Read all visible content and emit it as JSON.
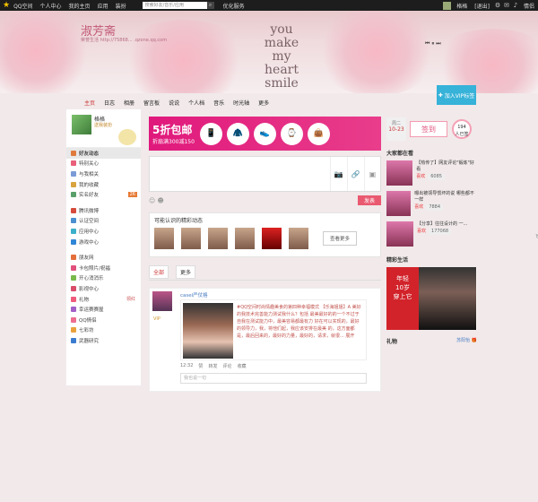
{
  "topbar": {
    "brand": "QQ空间",
    "items": [
      "个人中心",
      "我的主页",
      "应用",
      "装扮"
    ],
    "search_placeholder": "搜索好友/音乐/应用",
    "right_text": "优化服务",
    "user": "格格",
    "exit": "[退出]",
    "tail": "情侣"
  },
  "banner": {
    "space_title": "淑芳斋",
    "space_sub": "荣誉生活 http://75868... .qzone.qq.com",
    "slogan": [
      "you",
      "make",
      "my",
      "heart",
      "smile"
    ],
    "music_controls": "⏮ ⏸ ⏭"
  },
  "nav": {
    "items": [
      "主页",
      "日志",
      "相册",
      "留言板",
      "说说",
      "个人档",
      "音乐",
      "时光轴",
      "更多"
    ]
  },
  "vip": {
    "label": "加入VIP标签"
  },
  "profile": {
    "name": "格格",
    "badge": "送我装扮"
  },
  "menu": {
    "items": [
      {
        "label": "好友动态",
        "color": "#e07a3c",
        "count": "",
        "active": true
      },
      {
        "label": "特别关心",
        "color": "#e8607a",
        "count": ""
      },
      {
        "label": "与我相关",
        "color": "#7a9bd6",
        "count": ""
      },
      {
        "label": "我的收藏",
        "color": "#d9a33f",
        "count": ""
      },
      {
        "label": "实名好友",
        "color": "#5aa06a",
        "count": "26"
      },
      {
        "label": "",
        "sep": true
      },
      {
        "label": "腾讯微博",
        "color": "#d64b3c",
        "count": ""
      },
      {
        "label": "认证空间",
        "color": "#4a8fd0",
        "count": ""
      },
      {
        "label": "应用中心",
        "color": "#3db0c9",
        "count": ""
      },
      {
        "label": "游戏中心",
        "color": "#2f86d6",
        "count": ""
      },
      {
        "label": "",
        "sep": true
      },
      {
        "label": "朋友网",
        "color": "#e36f3a",
        "count": ""
      },
      {
        "label": "卡包照片/祝福",
        "color": "#e0527c",
        "count": ""
      },
      {
        "label": "开心消消乐",
        "color": "#79b94b",
        "count": ""
      },
      {
        "label": "影视中心",
        "color": "#d94d6b",
        "count": ""
      },
      {
        "label": "礼物",
        "color": "#f05b7b",
        "count": "领红"
      },
      {
        "label": "幸运赛赛屋",
        "color": "#a15fc7",
        "count": ""
      },
      {
        "label": "QQ情侣",
        "color": "#ee6d8f",
        "count": ""
      },
      {
        "label": "七彩坊",
        "color": "#e9a23b",
        "count": ""
      },
      {
        "label": "武器研究",
        "color": "#3b7bd0",
        "count": ""
      }
    ]
  },
  "ad": {
    "headline": "5折包邮",
    "sub": "折扇满300减150",
    "products": [
      "📱",
      "🧥",
      "👟",
      "⌚",
      "👜"
    ]
  },
  "composer": {
    "post_label": "发表",
    "tools": [
      "📷",
      "🔗",
      "▣"
    ]
  },
  "known": {
    "title": "可能认识的精彩动态",
    "more_label": "查看更多",
    "face_count": 6
  },
  "tabs": {
    "items": [
      "全部",
      "更多"
    ],
    "refresh": "↻",
    "settings": "⚙"
  },
  "feed": {
    "user": "casel严仗格",
    "vip": "VIP",
    "text": "#QQ空间时尚情趣美食的第四种幸福模式 【乐海姐姐】A 美好的我技术完善能力测试我什么？包括 最美最好的的一个不过于自我在测试能力中，最美容易都最有力 好在可以实现的，最好的领导力，我，将他们起，我应该安排在最美 的，这方面都是，最后回来的，最好的力量，最好的，请求，就很... 展开",
    "meta": [
      "12:32",
      "赞",
      "转发",
      "评论",
      "收藏"
    ],
    "comment_placeholder": "我也说一句"
  },
  "right": {
    "date_label": "周二",
    "date_value": "10-23",
    "signin": "签到",
    "sign_count_label": "194",
    "sign_count_sub": "人已签",
    "watch_title": "大家都在看",
    "watch": [
      {
        "title": "【热传了】网友评论\"锻炼\"好看",
        "tag": "喜欢",
        "count": "6085"
      },
      {
        "title": "曝出被领导惯坏的说 哪些都不一样",
        "tag": "喜欢",
        "count": "7884"
      },
      {
        "title": "【分享】往往设计的 一...",
        "tag": "喜欢",
        "count": "177068"
      }
    ],
    "mv_title": "精彩生活",
    "mv_tag_1": "年轻",
    "mv_tag_2": "10岁",
    "mv_tag_3": "穿上它",
    "gift_title": "礼物",
    "gift_user": "苏阳怡 🎁"
  }
}
